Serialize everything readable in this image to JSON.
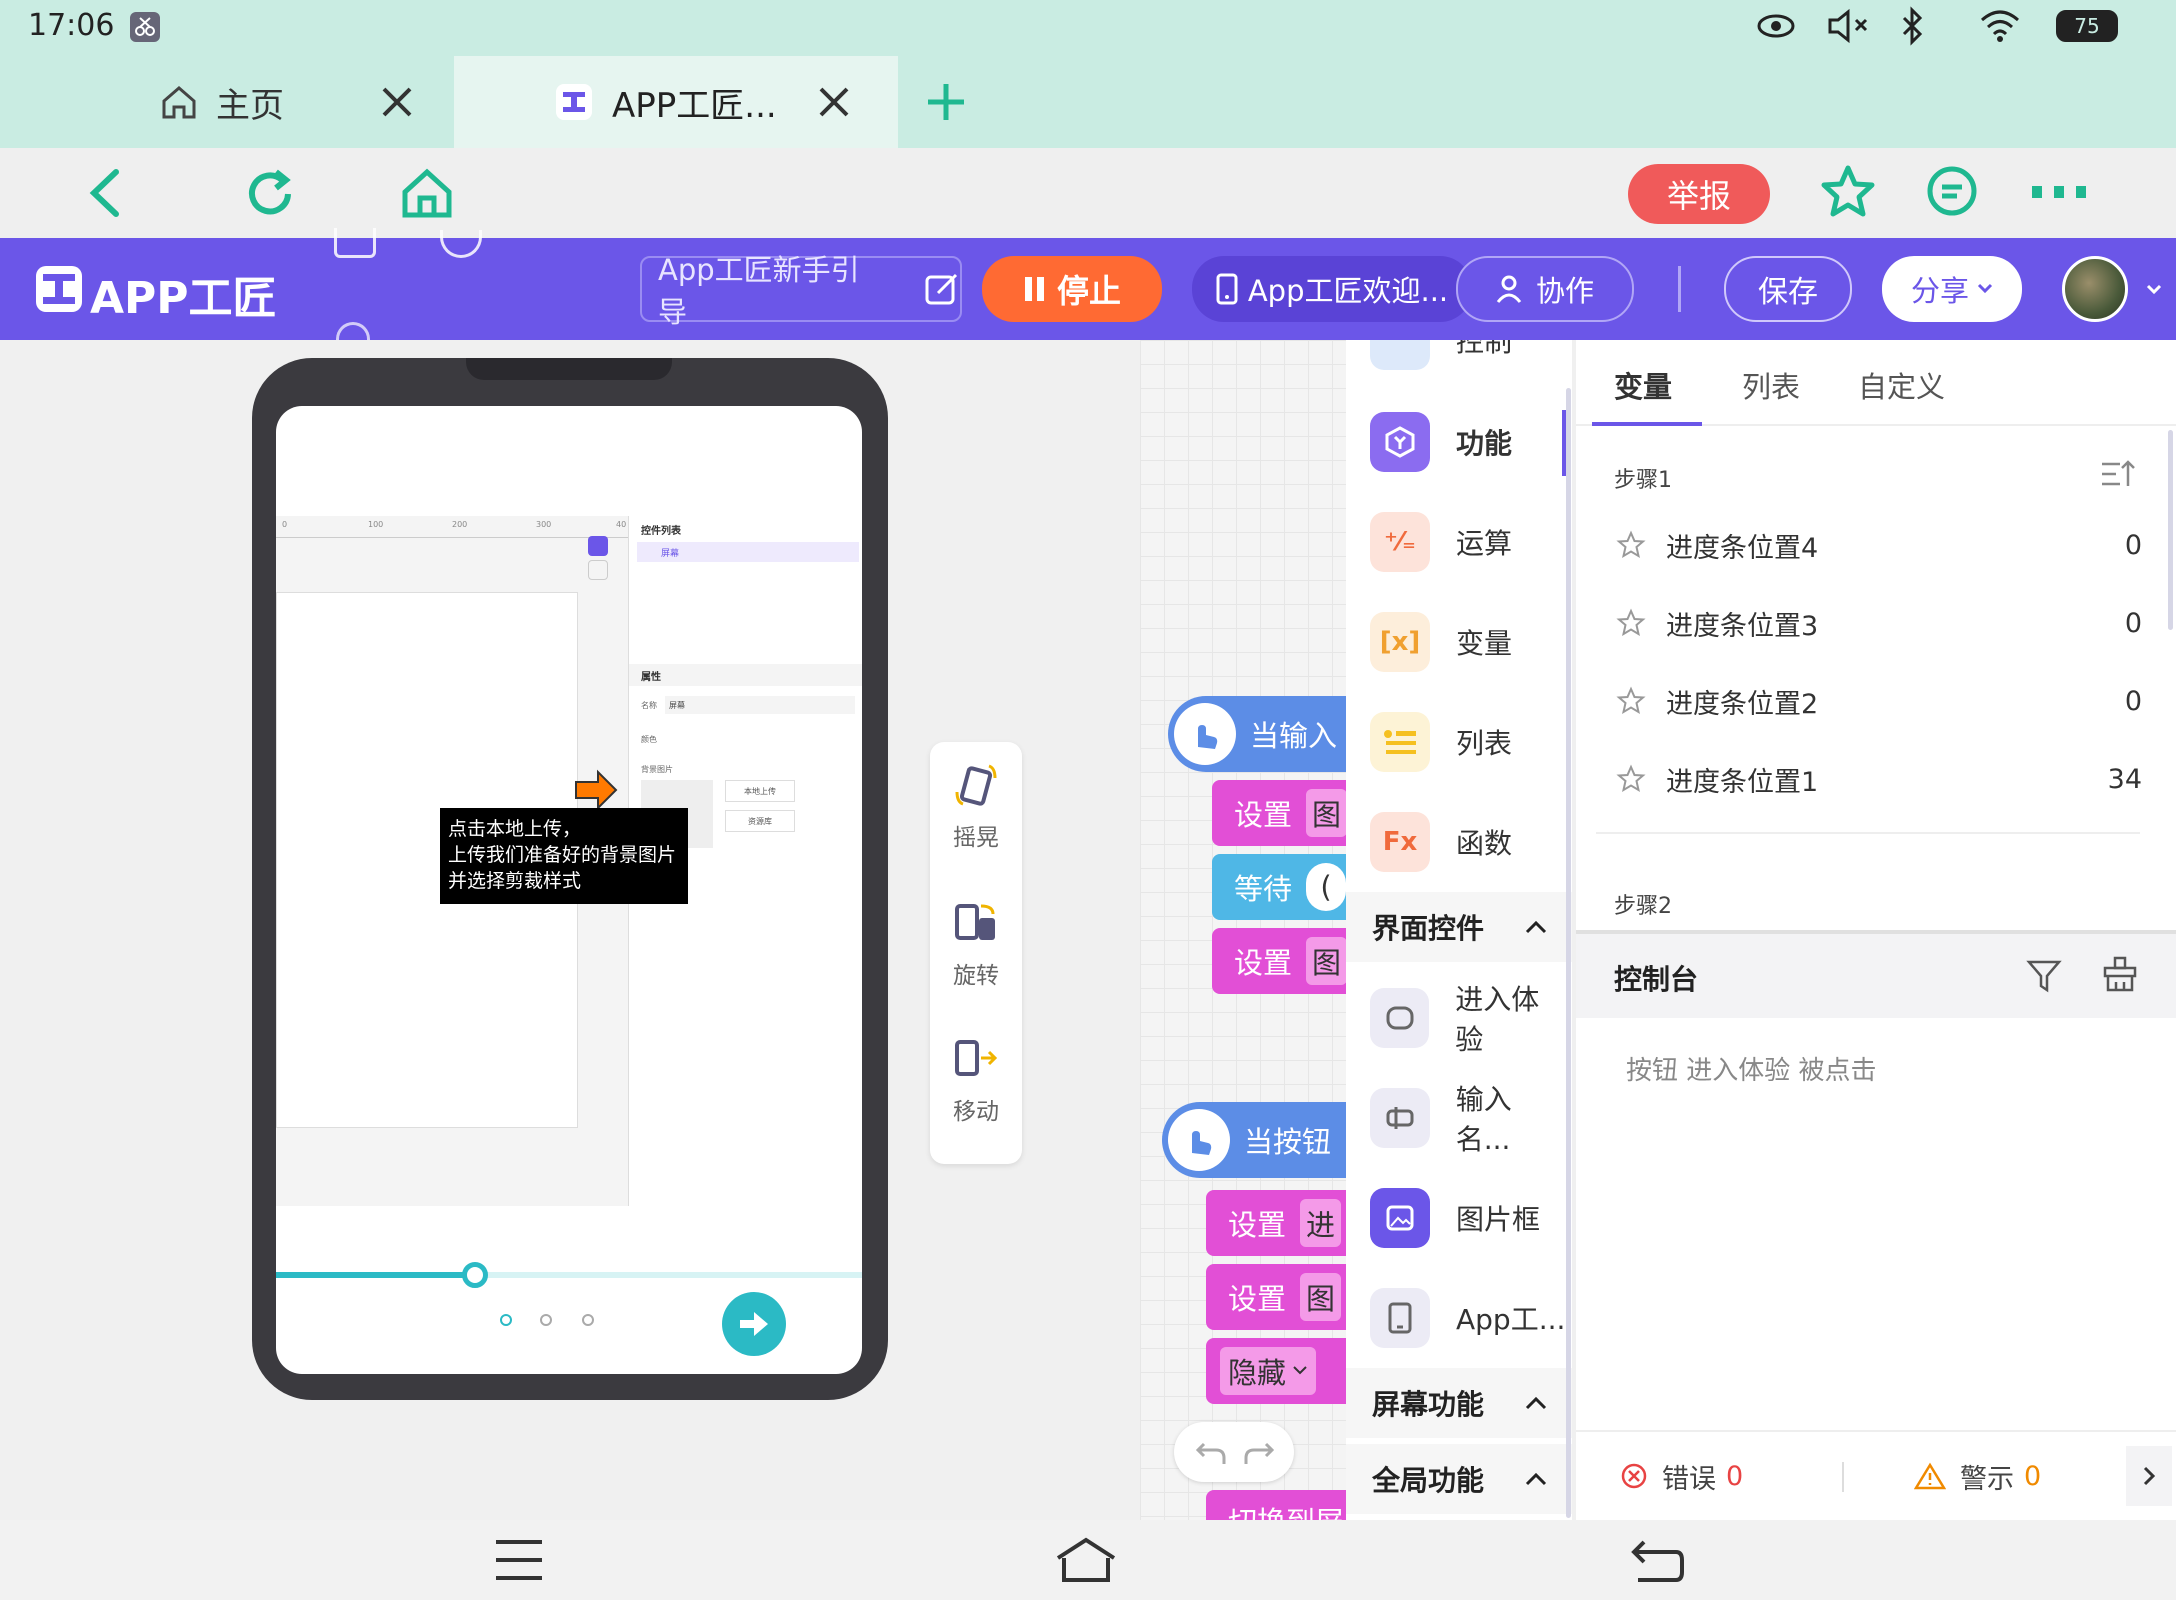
{
  "status": {
    "time": "17:06",
    "battery": "75"
  },
  "tabs": [
    {
      "label": "主页"
    },
    {
      "label": "APP工匠..."
    }
  ],
  "nav": {
    "report": "举报"
  },
  "app": {
    "logo": "APP工匠",
    "guide": "App工匠新手引导",
    "stop": "停止",
    "welcome": "App工匠欢迎...",
    "collab": "协作",
    "save": "保存",
    "share": "分享"
  },
  "preview": {
    "ruler_ticks": [
      "0",
      "100",
      "200",
      "300",
      "40"
    ],
    "widget_list_title": "控件列表",
    "widget_screen": "屏幕",
    "props_title": "属性",
    "prop_name_label": "名称",
    "prop_name_value": "屏幕",
    "prop_color_label": "颜色",
    "prop_bg_label": "背景图片",
    "upload_btn": "本地上传",
    "library_btn": "资源库",
    "tooltip": [
      "点击本地上传，",
      "上传我们准备好的背景图片",
      "并选择剪裁样式"
    ],
    "progress": 0.34
  },
  "motion": [
    {
      "label": "摇晃",
      "icon": "shake-icon"
    },
    {
      "label": "旋转",
      "icon": "rotate-icon"
    },
    {
      "label": "移动",
      "icon": "move-icon"
    }
  ],
  "blocks": {
    "event1": "当输入",
    "b1": "设置",
    "b1v": "图",
    "b2": "等待",
    "b2v": "(",
    "b3": "设置",
    "b3v": "图",
    "event2": "当按钮",
    "c1": "设置",
    "c1v": "进",
    "c2": "设置",
    "c2v": "图",
    "c3": "隐藏",
    "c4": "切换到屏"
  },
  "palette": {
    "cut_top": "控制",
    "items": [
      {
        "label": "功能",
        "icon": "function-icon",
        "bg": "#8b6cf0"
      },
      {
        "label": "运算",
        "icon": "operator-icon",
        "bg": "#fde3da"
      },
      {
        "label": "变量",
        "icon": "variable-icon",
        "bg": "#fdeedb"
      },
      {
        "label": "列表",
        "icon": "list-icon",
        "bg": "#fdf3d6"
      },
      {
        "label": "函数",
        "icon": "fx-icon",
        "bg": "#fde3da"
      }
    ],
    "section_ui": "界面控件",
    "ui_items": [
      {
        "label": "进入体验",
        "icon": "button-widget-icon"
      },
      {
        "label": "输入名...",
        "icon": "input-widget-icon"
      },
      {
        "label": "图片框",
        "icon": "image-widget-icon"
      },
      {
        "label": "App工...",
        "icon": "screen-widget-icon"
      }
    ],
    "section_screen": "屏幕功能",
    "section_global": "全局功能"
  },
  "variables": {
    "tabs": [
      "变量",
      "列表",
      "自定义"
    ],
    "step1": "步骤1",
    "rows": [
      {
        "name": "进度条位置4",
        "value": "0"
      },
      {
        "name": "进度条位置3",
        "value": "0"
      },
      {
        "name": "进度条位置2",
        "value": "0"
      },
      {
        "name": "进度条位置1",
        "value": "34"
      }
    ],
    "step2": "步骤2"
  },
  "console": {
    "title": "控制台",
    "log": "按钮 进入体验 被点击",
    "error_label": "错误",
    "error_count": "0",
    "warn_label": "警示",
    "warn_count": "0"
  }
}
